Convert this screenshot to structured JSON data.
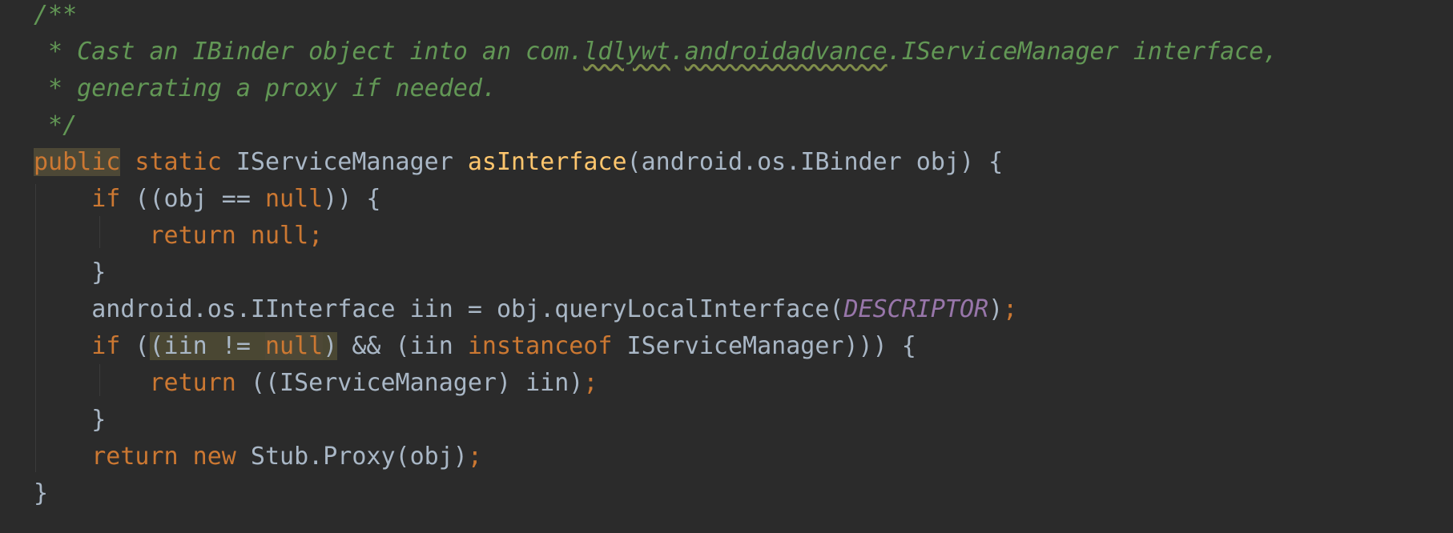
{
  "editor": {
    "language": "java",
    "colors": {
      "background": "#2b2b2b",
      "comment": "#629755",
      "keyword": "#cc7832",
      "method": "#ffc66d",
      "text": "#a9b7c6",
      "constant": "#9876aa"
    },
    "lines": [
      {
        "tokens": [
          {
            "text": "/**",
            "type": "comment"
          }
        ]
      },
      {
        "tokens": [
          {
            "text": " * Cast an IBinder object into an com.",
            "type": "comment"
          },
          {
            "text": "ldlywt",
            "type": "comment-squiggle"
          },
          {
            "text": ".",
            "type": "comment"
          },
          {
            "text": "androidadvance",
            "type": "comment-squiggle"
          },
          {
            "text": ".IServiceManager interface,",
            "type": "comment"
          }
        ]
      },
      {
        "tokens": [
          {
            "text": " * generating a proxy if needed.",
            "type": "comment"
          }
        ]
      },
      {
        "tokens": [
          {
            "text": " */",
            "type": "comment"
          }
        ]
      },
      {
        "tokens": [
          {
            "text": "public",
            "type": "keyword-hl"
          },
          {
            "text": " static ",
            "type": "keyword"
          },
          {
            "text": "IServiceManager ",
            "type": "plain"
          },
          {
            "text": "asInterface",
            "type": "method"
          },
          {
            "text": "(android.os.IBinder obj) {",
            "type": "plain"
          }
        ]
      },
      {
        "tokens": [
          {
            "text": "    ",
            "type": "plain"
          },
          {
            "text": "if",
            "type": "keyword"
          },
          {
            "text": " ((obj == ",
            "type": "plain"
          },
          {
            "text": "null",
            "type": "keyword"
          },
          {
            "text": ")) {",
            "type": "plain"
          }
        ]
      },
      {
        "tokens": [
          {
            "text": "        ",
            "type": "plain"
          },
          {
            "text": "return null;",
            "type": "keyword"
          }
        ]
      },
      {
        "tokens": [
          {
            "text": "    }",
            "type": "plain"
          }
        ]
      },
      {
        "tokens": [
          {
            "text": "    android.os.IInterface iin = obj.queryLocalInterface(",
            "type": "plain"
          },
          {
            "text": "DESCRIPTOR",
            "type": "constant"
          },
          {
            "text": ")",
            "type": "plain"
          },
          {
            "text": ";",
            "type": "semicolon"
          }
        ]
      },
      {
        "tokens": [
          {
            "text": "    ",
            "type": "plain"
          },
          {
            "text": "if",
            "type": "keyword"
          },
          {
            "text": " (",
            "type": "plain"
          },
          {
            "text": "(iin != ",
            "type": "plain-hl"
          },
          {
            "text": "null",
            "type": "keyword-hl"
          },
          {
            "text": ")",
            "type": "plain-hl"
          },
          {
            "text": " && (iin ",
            "type": "plain"
          },
          {
            "text": "instanceof",
            "type": "keyword"
          },
          {
            "text": " IServiceManager))) {",
            "type": "plain"
          }
        ]
      },
      {
        "tokens": [
          {
            "text": "        ",
            "type": "plain"
          },
          {
            "text": "return",
            "type": "keyword"
          },
          {
            "text": " ((IServiceManager) iin)",
            "type": "plain"
          },
          {
            "text": ";",
            "type": "semicolon"
          }
        ]
      },
      {
        "tokens": [
          {
            "text": "    }",
            "type": "plain"
          }
        ]
      },
      {
        "tokens": [
          {
            "text": "    ",
            "type": "plain"
          },
          {
            "text": "return new",
            "type": "keyword"
          },
          {
            "text": " Stub.Proxy(obj)",
            "type": "plain"
          },
          {
            "text": ";",
            "type": "semicolon"
          }
        ]
      },
      {
        "tokens": [
          {
            "text": "}",
            "type": "plain"
          }
        ]
      }
    ]
  }
}
